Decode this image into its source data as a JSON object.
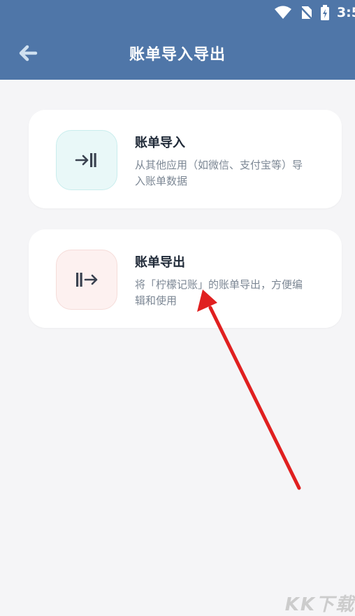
{
  "status_bar": {
    "time": "3:5",
    "icons": [
      "wifi-icon",
      "no-sim-icon",
      "battery-icon"
    ]
  },
  "header": {
    "title": "账单导入导出",
    "back_icon": "arrow-left-icon",
    "background": "#4f76a8"
  },
  "cards": [
    {
      "title": "账单导入",
      "description": "从其他应用（如微信、支付宝等）导入账单数据",
      "icon": "import-icon",
      "icon_color": "#e9f8f8"
    },
    {
      "title": "账单导出",
      "description": "将「柠檬记账」的账单导出，方便编辑和使用",
      "icon": "export-icon",
      "icon_color": "#fdf1f0"
    }
  ],
  "annotation": {
    "type": "arrow",
    "color": "#e02020"
  },
  "watermark": {
    "text": "KK下载"
  }
}
